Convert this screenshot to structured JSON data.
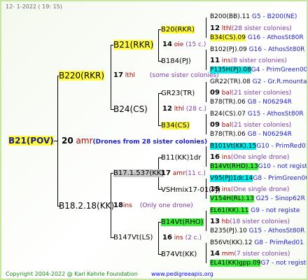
{
  "header": {
    "date": "12-  1-2022",
    "time": "( 19: 15)"
  },
  "colors": {
    "highlight_yellow": "#fffb3b",
    "highlight_green": "#3cf03c",
    "highlight_cyan": "#00ecec",
    "ins_red": "#b00000",
    "note_purple": "#7a3aa8",
    "desc_blue": "#1d1dc8"
  },
  "root": {
    "id": "B21(POV)",
    "num": "20",
    "ins": "amr",
    "note": "(Drones from 28 sister colonies)"
  },
  "b220": {
    "id": "B220(RKR)",
    "num": "17",
    "ins": "lthl",
    "note": "(some sister colonies)"
  },
  "b21": {
    "id": "B21(RKR)",
    "num": "14",
    "ins": "oie",
    "note": "(15 c.)"
  },
  "b20": {
    "id": "B20(RKR)"
  },
  "b200": {
    "id": "B200(BB).11",
    "desc": "G5 - B200(NE)"
  },
  "m12": {
    "num": "12",
    "ins": "lthl",
    "note": "(28 sister colonies)"
  },
  "b34pj": {
    "id": "B34(CS).09",
    "desc": "G16 - AthosSt80R"
  },
  "b184": {
    "id": "B184(PJ)"
  },
  "b102": {
    "id": "B102(PJ).09",
    "desc": "G16 - AthosSt80R"
  },
  "m11": {
    "num": "11",
    "ins": "ins",
    "note": "(8 sister colonies)"
  },
  "p135": {
    "id": "P135H(PJ).08",
    "desc": "G4 - PrimGreen00"
  },
  "b24": {
    "id": "B24(CS)"
  },
  "gr23": {
    "id": "GR23(TR)"
  },
  "gr22": {
    "id": "GR22(TR).08",
    "desc": "G2 - Gr.R.mounta"
  },
  "m09a": {
    "num": "09",
    "ins": "bal",
    "note": "(21 sister colonies)"
  },
  "b78a": {
    "id": "B78(TR).06",
    "desc": "G8 - N06294R"
  },
  "m12b": {
    "num": "12",
    "ins": "lthl",
    "note": "(28 c.)"
  },
  "b34cs": {
    "id": "B34(CS)"
  },
  "b24cs": {
    "id": "B24(CS).07",
    "desc": "G15 - AthosSt80R"
  },
  "m09b": {
    "num": "09",
    "ins": "bal",
    "note": "(21 sister colonies)"
  },
  "b78b": {
    "id": "B78(TR).06",
    "desc": "G8 - N06294R"
  },
  "b182": {
    "id": "B18.2.18(KK)",
    "num": "18",
    "ins": "ins",
    "note": "(Only one drone)"
  },
  "b171": {
    "id": "B17.1.537(KK)",
    "num": "17",
    "ins": "amr",
    "note": "(11 c.)"
  },
  "b111": {
    "id": "B11(KK)1dr"
  },
  "b101": {
    "id": "B101Vt(KK).15",
    "desc": "G10 - PrimRed01"
  },
  "m16a": {
    "num": "16",
    "ins": "ins",
    "note": "(One single drone)"
  },
  "b14rhd": {
    "id": "B14Vt(RHD).13",
    "desc": "G10 - not registe"
  },
  "vshmix": {
    "id": "VSHmix17-01(PJ)"
  },
  "v95": {
    "id": "V95(PJ)1dr.14",
    "desc": "G8 - PrimGreen00"
  },
  "m15": {
    "num": "15",
    "ins": "ins",
    "note": "(One single drone)"
  },
  "v154": {
    "id": "V154H(RL).13",
    "desc": "G25 - Sinop62R"
  },
  "b147": {
    "id": "B147Vt(LS)",
    "num": "16",
    "ins": "ins",
    "note": "(2 c.)"
  },
  "b14rho": {
    "id": "B14Vt(RHO)"
  },
  "el61": {
    "id": "EL61(KK).11",
    "desc": "G9 - not registe"
  },
  "m13": {
    "num": "13",
    "ins": "hb",
    "note": "(18 sister colonies)"
  },
  "b235": {
    "id": "B235(PJ).10",
    "desc": "G15 - AthosSt80R"
  },
  "b74": {
    "id": "B74Vt(KK)"
  },
  "b56": {
    "id": "B56Vt(KK).12",
    "desc": "G8 - PrimRed01"
  },
  "m14": {
    "num": "14",
    "ins": "mm",
    "note": "(7 sister colonies)"
  },
  "el41": {
    "id": "EL41(KK)gpp.09",
    "desc": "G7 - not registe"
  },
  "footer": {
    "copyright": "Copyright 2004-2022 @ Karl Kehrle Foundation",
    "url": "www.pedigreeapis.org"
  }
}
